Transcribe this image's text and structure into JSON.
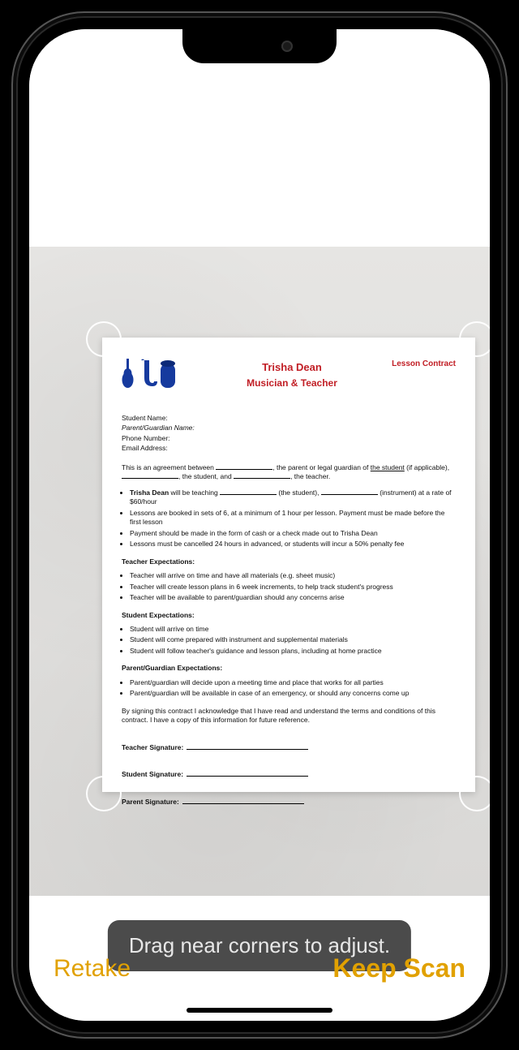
{
  "tooltip": "Drag near corners to adjust.",
  "buttons": {
    "retake": "Retake",
    "keep": "Keep Scan"
  },
  "doc": {
    "header": {
      "name": "Trisha Dean",
      "role": "Musician & Teacher",
      "tag": "Lesson Contract"
    },
    "fields": {
      "student_name_label": "Student Name:",
      "parent_label": "Parent/Guardian Name:",
      "phone_label": "Phone Number:",
      "email_label": "Email Address:"
    },
    "intro": {
      "p1a": "This is an agreement between ",
      "p1b": ", the parent or legal guardian of ",
      "p1c": "the student",
      "p1d": " (if applicable), ",
      "p1e": ", the student, and ",
      "p1f": ", the teacher."
    },
    "terms": {
      "b1a": "Trisha Dean",
      "b1b": " will be teaching ",
      "b1c": " (the student), ",
      "b1d": " (instrument) at a rate of $60/hour",
      "b2": "Lessons are booked in sets of 6, at a minimum of 1 hour per lesson. Payment must be made before the first lesson",
      "b3": "Payment should be made in the form of cash or a check made out to Trisha Dean",
      "b4": "Lessons must be cancelled 24 hours in advanced, or students will incur a 50% penalty fee"
    },
    "teacher": {
      "title": "Teacher Expectations:",
      "b1": "Teacher will arrive on time and have all materials (e.g. sheet music)",
      "b2": "Teacher will create lesson plans in 6 week increments, to help track student's progress",
      "b3": "Teacher will be available to parent/guardian should any concerns arise"
    },
    "student": {
      "title": "Student Expectations:",
      "b1": "Student will arrive on time",
      "b2": "Student will come prepared with instrument and supplemental materials",
      "b3": "Student will follow teacher's guidance and lesson plans, including at home practice"
    },
    "parent": {
      "title": "Parent/Guardian Expectations:",
      "b1": "Parent/guardian will decide upon a meeting time and place that works for all parties",
      "b2": "Parent/guardian will be available in case of an emergency, or should any concerns come up"
    },
    "ack": "By signing this contract I acknowledge that I have read and understand the terms and conditions of this contract. I have a copy of this information for future reference.",
    "sig": {
      "teacher": "Teacher Signature:",
      "student": "Student Signature:",
      "parent": "Parent Signature:"
    }
  }
}
